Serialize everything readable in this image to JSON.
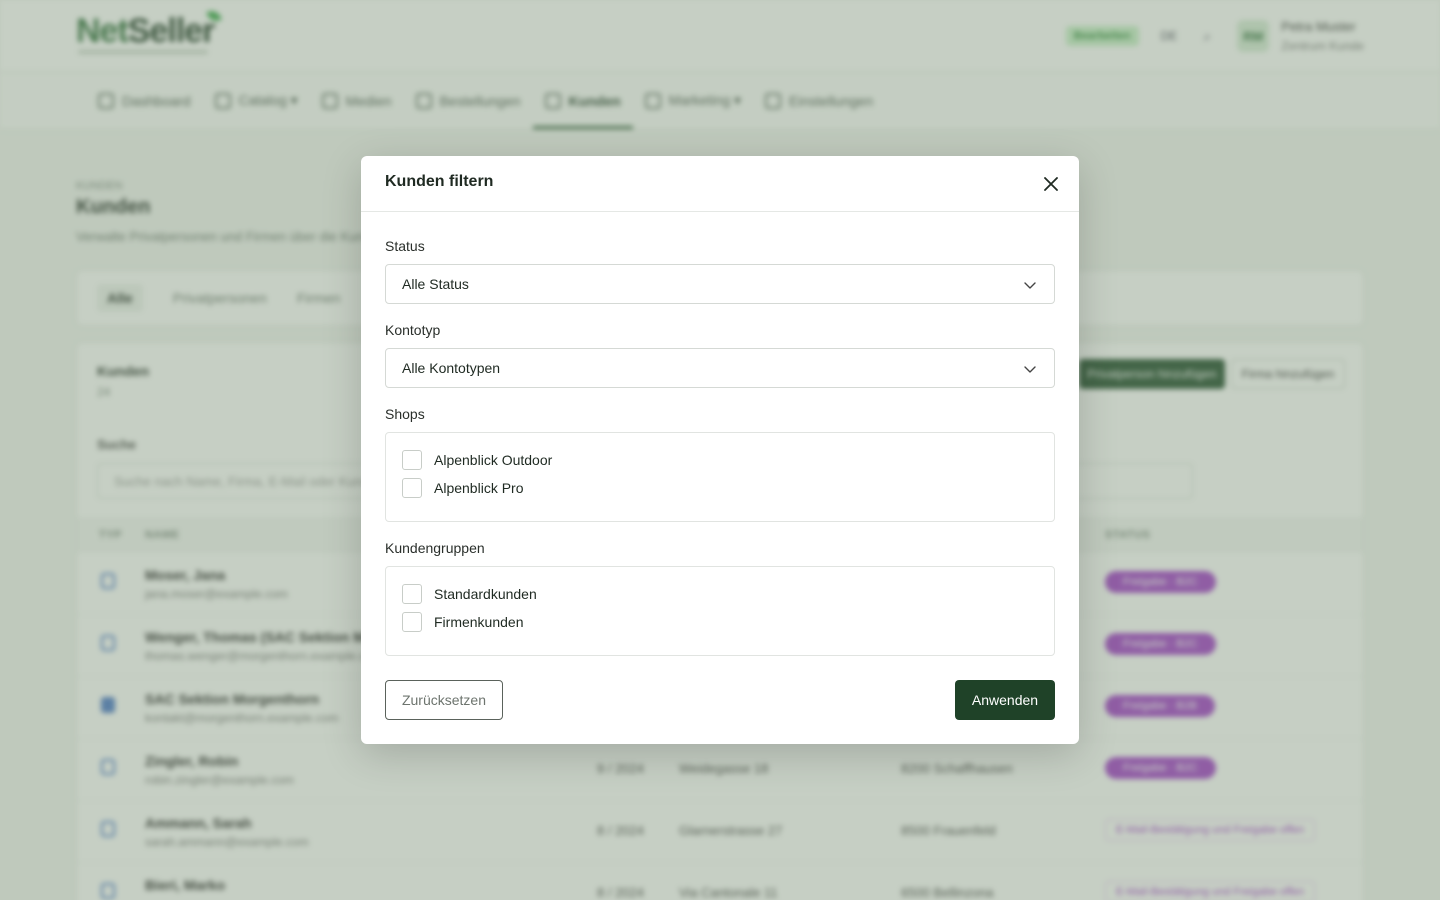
{
  "background": {
    "brand": {
      "logo_text_1": "Net",
      "logo_text_2": "Seller"
    },
    "topbar": {
      "badge": "Bearbeiten",
      "lang": "DE",
      "user_initials": "RM",
      "user_name": "Petra Muster",
      "user_role": "Zentrum Kunde"
    },
    "nav": [
      {
        "label": "Dashboard"
      },
      {
        "label": "Catalog ▾"
      },
      {
        "label": "Medien"
      },
      {
        "label": "Bestellungen"
      },
      {
        "label": "Kunden"
      },
      {
        "label": "Marketing ▾"
      },
      {
        "label": "Einstellungen"
      }
    ],
    "page": {
      "breadcrumb": "KUNDEN",
      "title": "Kunden",
      "description": "Verwalte Privatpersonen und Firmen über die Kundenverwaltung."
    },
    "tabs": [
      "Alle",
      "Privatpersonen",
      "Firmen"
    ],
    "list": {
      "title": "Kunden",
      "count": "24",
      "btn_primary": "Privatperson hinzufügen",
      "btn_secondary": "Firma hinzufügen",
      "search_label": "Suche",
      "search_placeholder": "Suche nach Name, Firma, E-Mail oder Kundennummer",
      "columns": {
        "typ": "TYP",
        "name": "NAME",
        "status": "STATUS"
      },
      "rows": [
        {
          "name": "Moser, Jana",
          "mail": "jana.moser@example.com",
          "date": "",
          "street": "",
          "city": "",
          "tag": "Freigabe · B2C"
        },
        {
          "name": "Wenger, Thomas (SAC Sektion Morgenthorn)",
          "mail": "thomas.wenger@morgenthorn.example.com",
          "date": "",
          "street": "",
          "city": "",
          "tag": "Freigabe · B2C"
        },
        {
          "name": "SAC Sektion Morgenthorn",
          "mail": "kontakt@morgenthorn.example.com",
          "date": "",
          "street": "",
          "city": "",
          "tag": "Freigabe · B2B"
        },
        {
          "name": "Zingler, Robin",
          "mail": "robin.zingler@example.com",
          "date": "9 / 2024",
          "street": "Weidegasse 18",
          "city": "8200 Schaffhausen",
          "tag": "Freigabe · B2C"
        },
        {
          "name": "Ammann, Sarah",
          "mail": "sarah.ammann@example.com",
          "date": "8 / 2024",
          "street": "Glarnerstrasse 27",
          "city": "8500 Frauenfeld",
          "tag": "E-Mail-Bestätigung und Freigabe offen"
        },
        {
          "name": "Bieri, Marko",
          "mail": "",
          "date": "8 / 2024",
          "street": "Via Cantonale 11",
          "city": "6500 Bellinzona",
          "tag": "E-Mail-Bestätigung und Freigabe offen"
        }
      ]
    }
  },
  "modal": {
    "title": "Kunden filtern",
    "status": {
      "label": "Status",
      "value": "Alle Status"
    },
    "kontotyp": {
      "label": "Kontotyp",
      "value": "Alle Kontotypen"
    },
    "shops": {
      "label": "Shops",
      "options": [
        "Alpenblick Outdoor",
        "Alpenblick Pro"
      ]
    },
    "kundengruppen": {
      "label": "Kundengruppen",
      "options": [
        "Standardkunden",
        "Firmenkunden"
      ]
    },
    "reset_label": "Zurücksetzen",
    "apply_label": "Anwenden"
  },
  "colors": {
    "primary": "#1f4228",
    "overlay": "#788c73",
    "tag_purple": "#a23cc9",
    "link_blue": "#4a78c9"
  },
  "icons": {
    "close": "close-icon",
    "select_chevron": "chevron-down-icon",
    "search": "search-icon"
  }
}
